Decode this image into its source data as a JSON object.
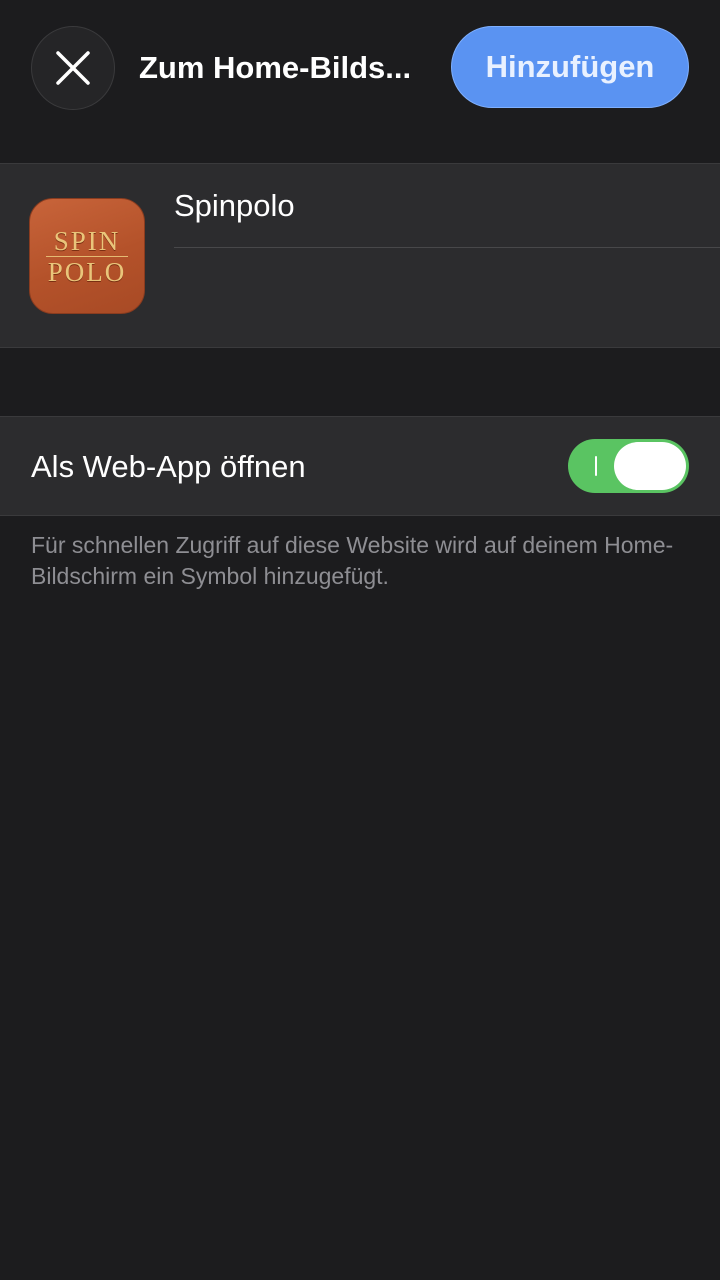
{
  "header": {
    "title": "Zum Home-Bilds...",
    "add_label": "Hinzufügen",
    "close_icon": "close-icon"
  },
  "app": {
    "name": "Spinpolo",
    "icon": {
      "line1": "SPIN",
      "line2": "POLO",
      "background": "#b4522a",
      "text_color": "#e9c57a"
    }
  },
  "settings": {
    "web_app_label": "Als Web-App öffnen",
    "web_app_enabled": true,
    "description": "Für schnellen Zugriff auf diese Website wird auf deinem Home-Bildschirm ein Symbol hinzugefügt."
  },
  "colors": {
    "accent": "#5a93f2",
    "toggle_on": "#5ac462",
    "background": "#1c1c1e",
    "card": "#2c2c2e"
  }
}
